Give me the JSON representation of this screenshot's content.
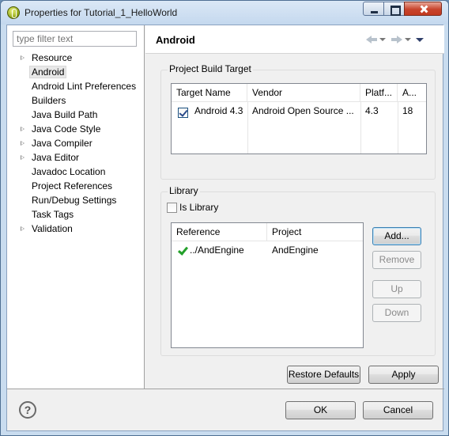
{
  "window": {
    "title": "Properties for Tutorial_1_HelloWorld"
  },
  "filter": {
    "placeholder": "type filter text"
  },
  "tree": [
    {
      "label": "Resource",
      "expandable": true
    },
    {
      "label": "Android",
      "expandable": false,
      "selected": true
    },
    {
      "label": "Android Lint Preferences",
      "expandable": false
    },
    {
      "label": "Builders",
      "expandable": false
    },
    {
      "label": "Java Build Path",
      "expandable": false
    },
    {
      "label": "Java Code Style",
      "expandable": true
    },
    {
      "label": "Java Compiler",
      "expandable": true
    },
    {
      "label": "Java Editor",
      "expandable": true
    },
    {
      "label": "Javadoc Location",
      "expandable": false
    },
    {
      "label": "Project References",
      "expandable": false
    },
    {
      "label": "Run/Debug Settings",
      "expandable": false
    },
    {
      "label": "Task Tags",
      "expandable": false
    },
    {
      "label": "Validation",
      "expandable": true
    }
  ],
  "page": {
    "title": "Android"
  },
  "build_target": {
    "legend": "Project Build Target",
    "columns": [
      "Target Name",
      "Vendor",
      "Platf...",
      "A..."
    ],
    "rows": [
      {
        "checked": true,
        "target": "Android 4.3",
        "vendor": "Android Open Source ...",
        "platform": "4.3",
        "api": "18"
      }
    ]
  },
  "library": {
    "legend": "Library",
    "is_library_label": "Is Library",
    "is_library_checked": false,
    "columns": [
      "Reference",
      "Project"
    ],
    "rows": [
      {
        "reference": "../AndEngine",
        "project": "AndEngine",
        "ok": true
      }
    ],
    "buttons": {
      "add": "Add...",
      "remove": "Remove",
      "up": "Up",
      "down": "Down"
    }
  },
  "footer": {
    "restore_defaults": "Restore Defaults",
    "apply": "Apply",
    "ok": "OK",
    "cancel": "Cancel",
    "help": "?"
  }
}
